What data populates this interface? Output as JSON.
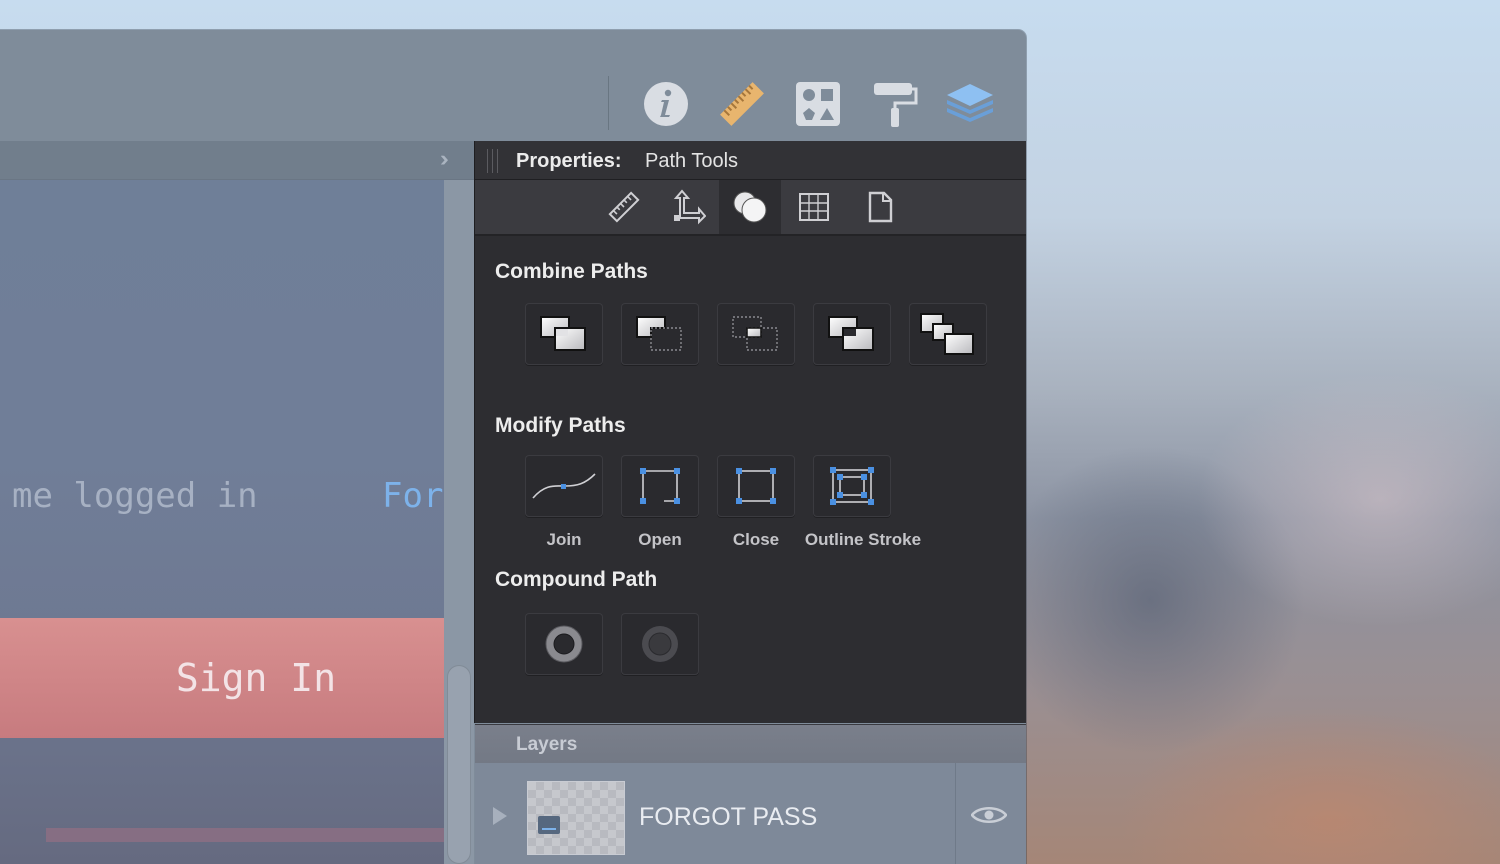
{
  "toolbar": {
    "icons": [
      "info-icon",
      "ruler-icon",
      "shapes-icon",
      "paint-roller-icon",
      "layers-icon"
    ]
  },
  "canvas": {
    "remember_text": "me logged in",
    "forgot_link": "For",
    "signin_label": "Sign In"
  },
  "properties": {
    "title_label": "Properties:",
    "title_value": "Path Tools",
    "tabs": [
      "ruler-tab-icon",
      "transform-tab-icon",
      "path-tools-tab-icon",
      "grid-tab-icon",
      "document-tab-icon"
    ],
    "active_tab": "path-tools-tab-icon",
    "combine": {
      "title": "Combine Paths",
      "buttons": [
        "union-icon",
        "subtract-icon",
        "intersect-icon",
        "exclude-icon",
        "divide-icon"
      ]
    },
    "modify": {
      "title": "Modify Paths",
      "buttons": [
        {
          "label": "Join",
          "icon": "join-path-icon"
        },
        {
          "label": "Open",
          "icon": "open-path-icon"
        },
        {
          "label": "Close",
          "icon": "close-path-icon"
        },
        {
          "label": "Outline Stroke",
          "icon": "outline-stroke-icon"
        }
      ]
    },
    "compound": {
      "title": "Compound Path",
      "buttons": [
        "make-compound-icon",
        "release-compound-icon"
      ]
    }
  },
  "layers": {
    "title": "Layers",
    "rows": [
      {
        "name": "FORGOT PASS",
        "visible": true
      }
    ]
  },
  "colors": {
    "panel_bg": "#2d2d31",
    "accent_blue": "#4a90e2",
    "signin_bg": "#d08888",
    "link_blue": "#7db2ea"
  }
}
